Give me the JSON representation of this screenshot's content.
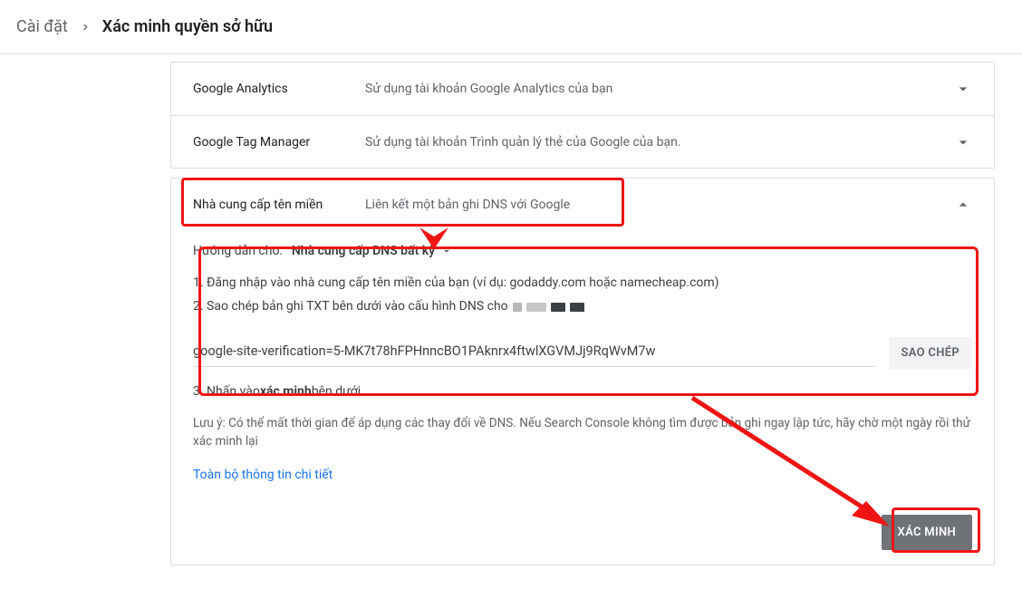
{
  "breadcrumb": {
    "settings": "Cài đặt",
    "current": "Xác minh quyền sở hữu"
  },
  "methods": {
    "analytics": {
      "title": "Google Analytics",
      "desc": "Sử dụng tài khoản Google Analytics của bạn"
    },
    "gtm": {
      "title": "Google Tag Manager",
      "desc": "Sử dụng tài khoản Trình quản lý thẻ của Google của bạn."
    },
    "dns": {
      "title": "Nhà cung cấp tên miền",
      "desc": "Liên kết một bản ghi DNS với Google"
    }
  },
  "dns_panel": {
    "instr_label": "Hướng dẫn cho:",
    "provider": "Nhà cung cấp DNS bất kỳ",
    "step1": "1. Đăng nhập vào nhà cung cấp tên miền của bạn (ví dụ: godaddy.com hoặc namecheap.com)",
    "step2": "2. Sao chép bản ghi TXT bên dưới vào cấu hình DNS cho",
    "txt_record": "google-site-verification=5-MK7t78hFPHnncBO1PAknrx4ftwlXGVMJj9RqWvM7w",
    "copy_label": "SAO CHÉP",
    "step3_pre": "3. Nhấn vào ",
    "step3_bold": "xác minh",
    "step3_post": " bên dưới",
    "note": "Lưu ý: Có thể mất thời gian để áp dụng các thay đổi về DNS. Nếu Search Console không tìm được bản ghi ngay lập tức, hãy chờ một ngày rồi thử xác minh lại",
    "details_link": "Toàn bộ thông tin chi tiết",
    "verify_label": "XÁC MINH"
  }
}
